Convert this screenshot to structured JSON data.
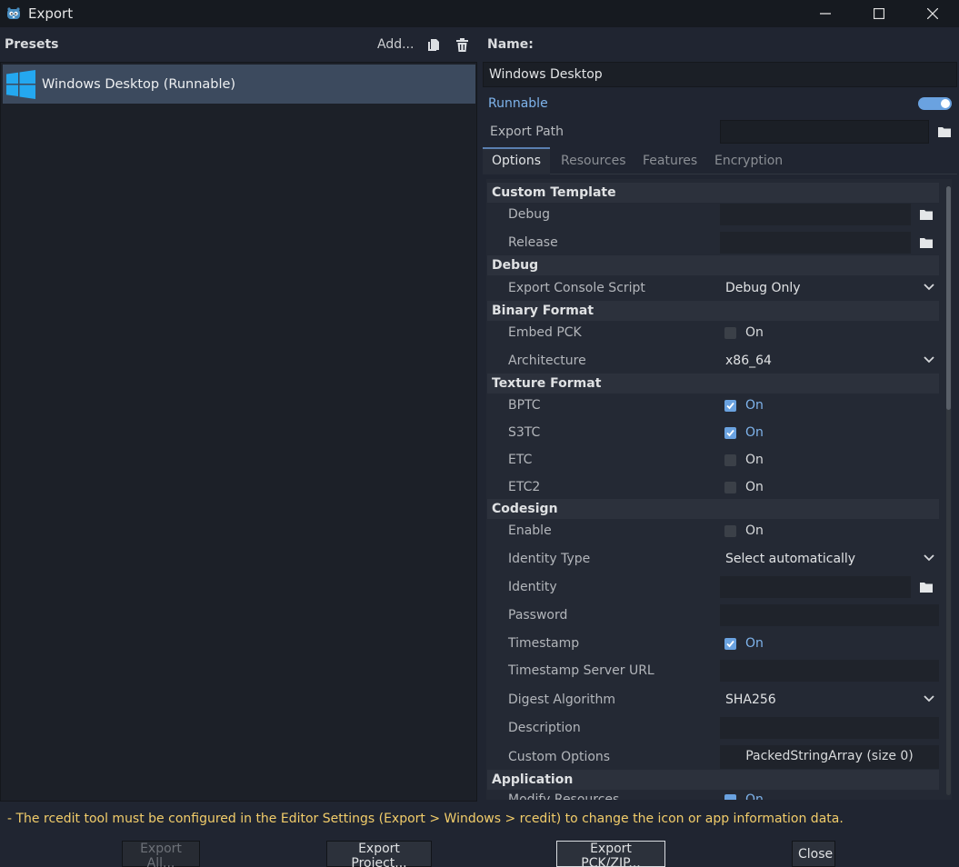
{
  "window": {
    "title": "Export"
  },
  "presets": {
    "title": "Presets",
    "add_label": "Add...",
    "items": [
      {
        "label": "Windows Desktop (Runnable)"
      }
    ]
  },
  "preset_detail": {
    "name_label": "Name:",
    "name_value": "Windows Desktop",
    "runnable_label": "Runnable",
    "runnable_on": true,
    "export_path_label": "Export Path",
    "export_path_value": ""
  },
  "tabs": [
    {
      "label": "Options",
      "active": true
    },
    {
      "label": "Resources",
      "active": false
    },
    {
      "label": "Features",
      "active": false
    },
    {
      "label": "Encryption",
      "active": false
    }
  ],
  "options": {
    "sections": {
      "custom_template": "Custom Template",
      "debug": "Debug",
      "binary_format": "Binary Format",
      "texture_format": "Texture Format",
      "codesign": "Codesign",
      "application": "Application"
    },
    "custom_template_debug": "Debug",
    "custom_template_release": "Release",
    "export_console_script": {
      "label": "Export Console Script",
      "value": "Debug Only"
    },
    "embed_pck": {
      "label": "Embed PCK",
      "text": "On",
      "checked": false
    },
    "architecture": {
      "label": "Architecture",
      "value": "x86_64"
    },
    "bptc": {
      "label": "BPTC",
      "text": "On",
      "checked": true
    },
    "s3tc": {
      "label": "S3TC",
      "text": "On",
      "checked": true
    },
    "etc": {
      "label": "ETC",
      "text": "On",
      "checked": false
    },
    "etc2": {
      "label": "ETC2",
      "text": "On",
      "checked": false
    },
    "codesign_enable": {
      "label": "Enable",
      "text": "On",
      "checked": false
    },
    "identity_type": {
      "label": "Identity Type",
      "value": "Select automatically"
    },
    "identity": {
      "label": "Identity"
    },
    "password": {
      "label": "Password"
    },
    "timestamp": {
      "label": "Timestamp",
      "text": "On",
      "checked": true
    },
    "timestamp_url": {
      "label": "Timestamp Server URL"
    },
    "digest_algorithm": {
      "label": "Digest Algorithm",
      "value": "SHA256"
    },
    "description": {
      "label": "Description"
    },
    "custom_options": {
      "label": "Custom Options",
      "value": "PackedStringArray (size 0)"
    },
    "modify_resources": {
      "label": "Modify Resources",
      "text": "On",
      "checked": true
    }
  },
  "warning": "- The rcedit tool must be configured in the Editor Settings (Export > Windows > rcedit) to change the icon or app information data.",
  "buttons": {
    "export_all": "Export All...",
    "export_project": "Export Project...",
    "export_pck": "Export PCK/ZIP...",
    "close": "Close"
  },
  "colors": {
    "accent": "#6aa2e0",
    "warning": "#f2cd6a",
    "selection": "#3c4a5e"
  }
}
